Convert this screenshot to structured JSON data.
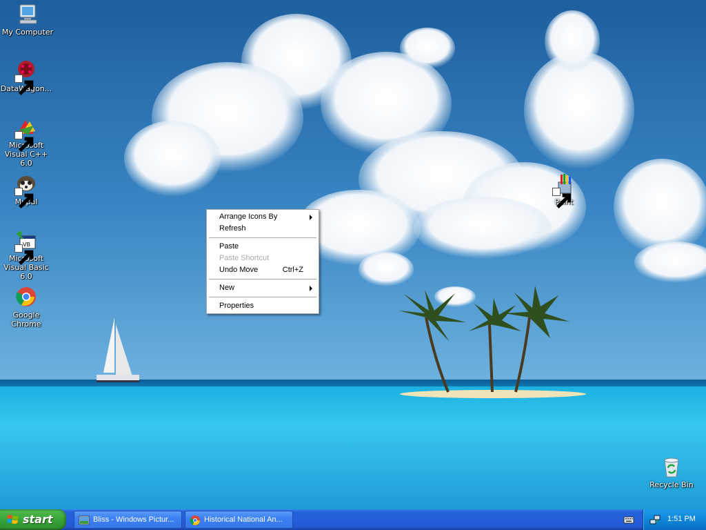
{
  "desktop": {
    "icons": [
      {
        "label": "My Computer",
        "icon": "my-computer-icon"
      },
      {
        "label": "DataWagon...",
        "icon": "datawagon-icon"
      },
      {
        "label": "Microsoft Visual C++ 6.0",
        "icon": "visual-cpp-icon"
      },
      {
        "label": "Mypal",
        "icon": "mypal-icon"
      },
      {
        "label": "Microsoft Visual Basic 6.0",
        "icon": "visual-basic-icon"
      },
      {
        "label": "Google Chrome",
        "icon": "chrome-icon"
      },
      {
        "label": "Paint",
        "icon": "paint-icon"
      },
      {
        "label": "Recycle Bin",
        "icon": "recycle-bin-icon"
      }
    ]
  },
  "context_menu": {
    "arrange": "Arrange Icons By",
    "refresh": "Refresh",
    "paste": "Paste",
    "paste_shortcut": "Paste Shortcut",
    "undo_move": "Undo Move",
    "undo_move_key": "Ctrl+Z",
    "new": "New",
    "properties": "Properties"
  },
  "taskbar": {
    "start_label": "start",
    "tasks": [
      {
        "label": "Bliss - Windows Pictur...",
        "icon": "picture-viewer-icon"
      },
      {
        "label": "Historical National An...",
        "icon": "chrome-icon"
      }
    ],
    "clock": "1:51 PM"
  },
  "colors": {
    "taskbar": "#245edb",
    "start": "#39a539",
    "tray": "#0f86d8",
    "sky": "#2f7fc0",
    "sea": "#3fc3e8"
  }
}
